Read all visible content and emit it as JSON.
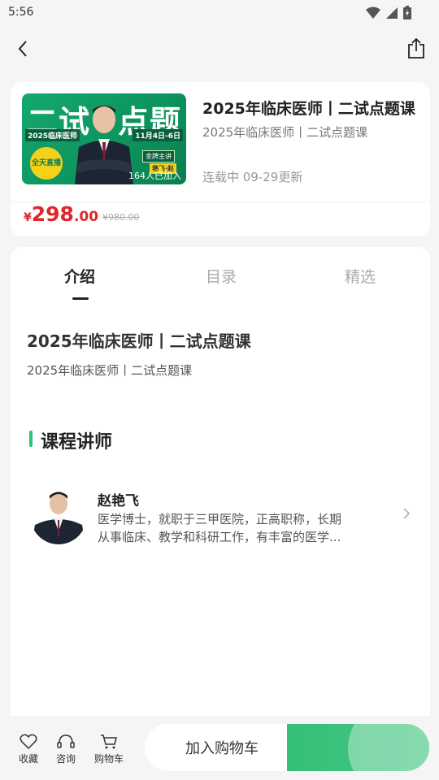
{
  "status_bar": {
    "time": "5:56"
  },
  "course": {
    "title": "2025年临床医师丨二试点题课",
    "subtitle": "2025年临床医师丨二试点题课",
    "status": "连载中 09-29更新",
    "price_symbol": "¥",
    "price_integer": "298",
    "price_decimal": ".00",
    "original_price": "¥980.00",
    "cover": {
      "big_text_1": "二试",
      "big_text_2": "点题",
      "tag_left": "2025临床医师",
      "tag_right": "11月4日-6日",
      "badge": "全天直播",
      "gold_label": "金牌主讲",
      "lecturer_label": "艳飞·赵",
      "joined": "164人已加入"
    }
  },
  "tabs": [
    {
      "label": "介绍"
    },
    {
      "label": "目录"
    },
    {
      "label": "精选"
    }
  ],
  "intro": {
    "title": "2025年临床医师丨二试点题课",
    "subtitle": "2025年临床医师丨二试点题课"
  },
  "lecturer_section": {
    "title": "课程讲师",
    "name": "赵艳飞",
    "desc_line1": "医学博士，就职于三甲医院，正高职称，长期",
    "desc_line2": "从事临床、教学和科研工作，有丰富的医学..."
  },
  "bottom_bar": {
    "favorite": "收藏",
    "consult": "咨询",
    "cart": "购物车",
    "add_to_cart": "加入购物车"
  },
  "colors": {
    "accent_green": "#34bf78",
    "price_red": "#e0262b"
  }
}
